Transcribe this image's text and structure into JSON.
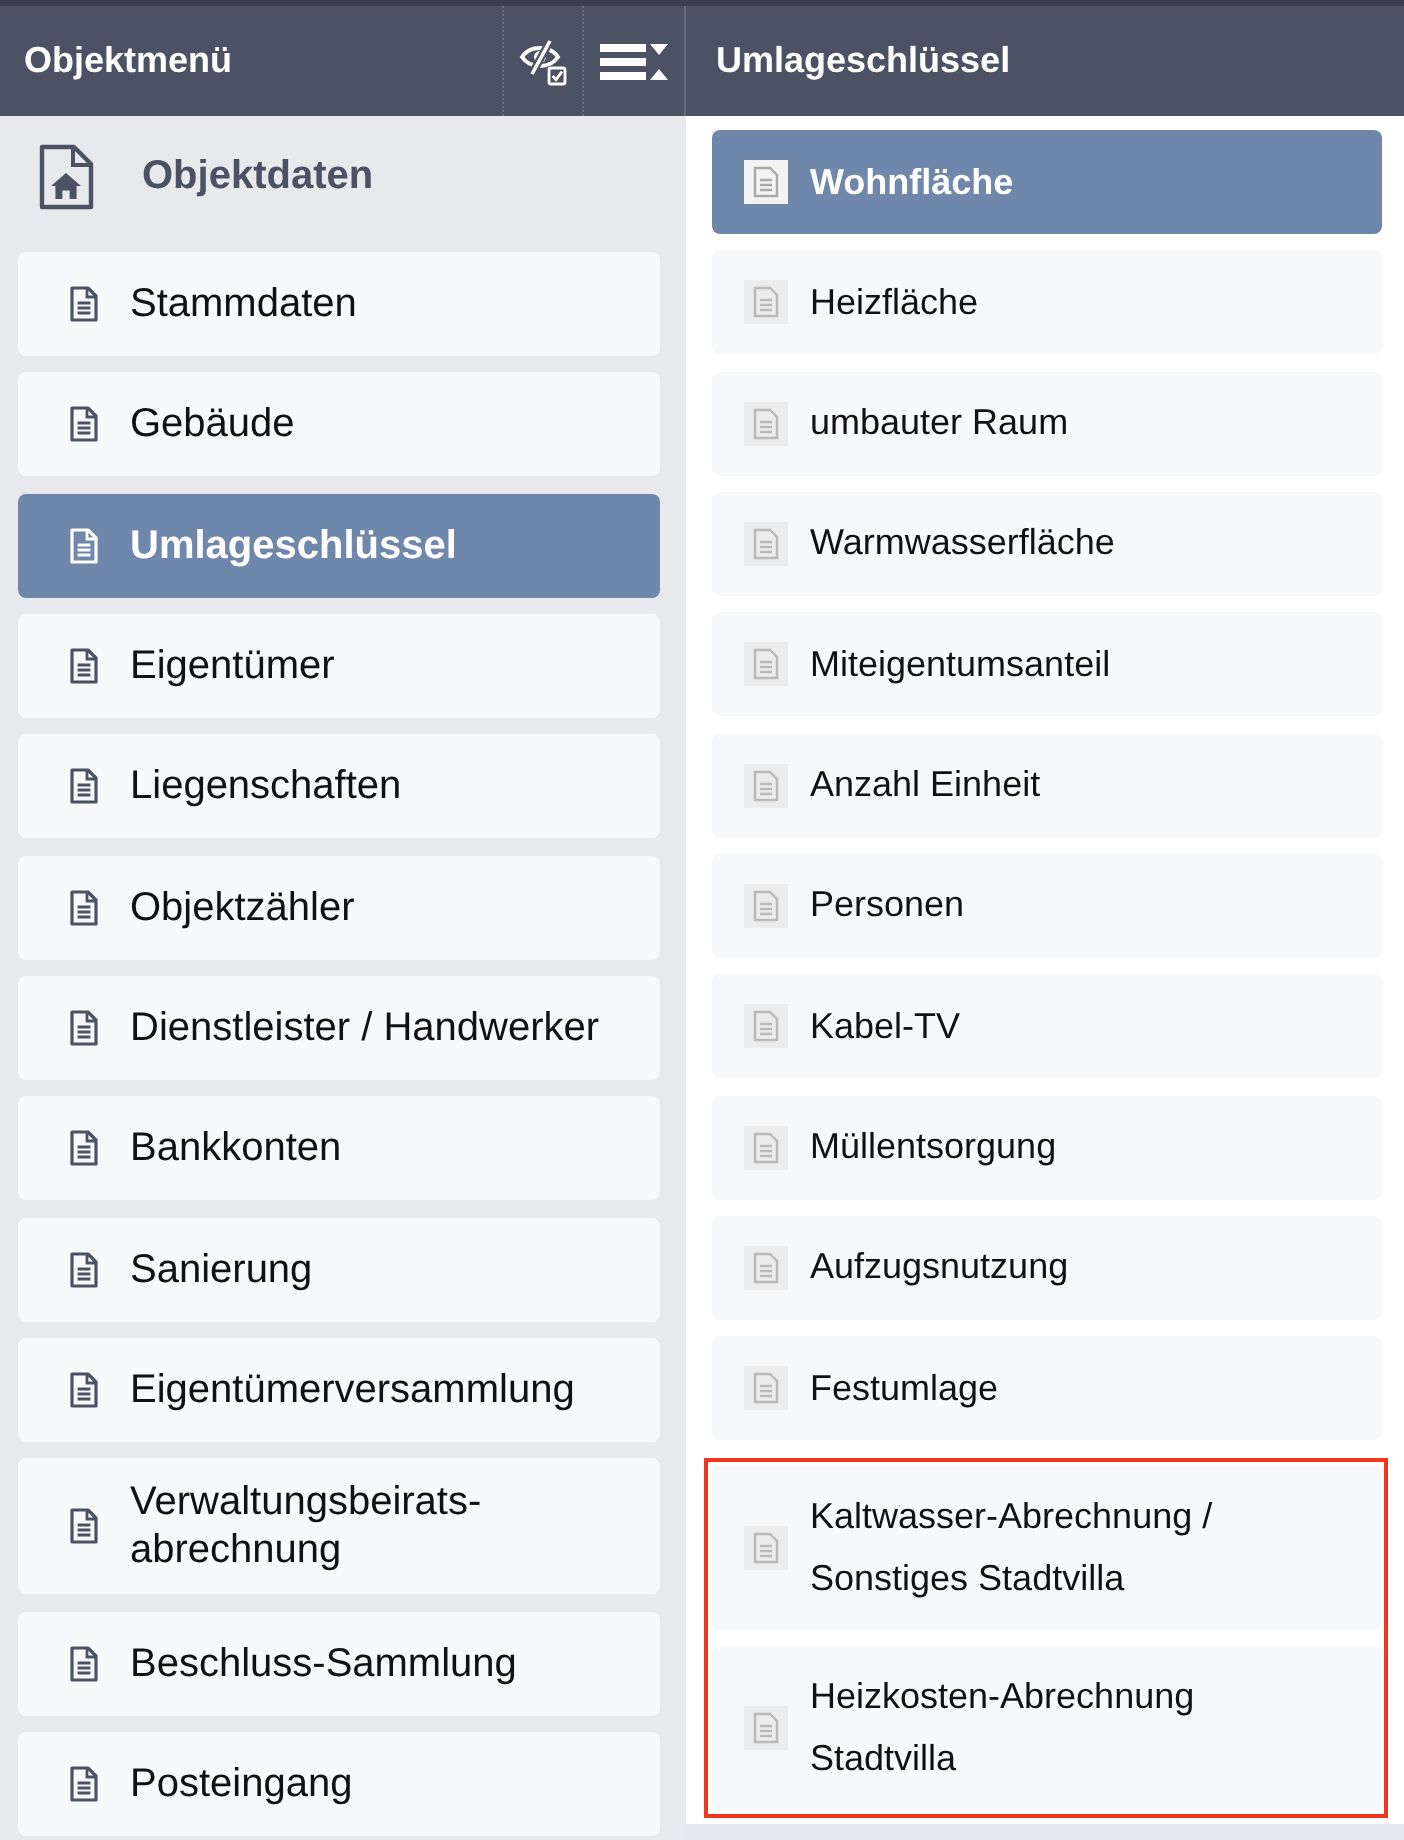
{
  "left_panel": {
    "title": "Objektmenü",
    "section": {
      "title": "Objektdaten"
    },
    "items": [
      {
        "label": "Stammdaten",
        "selected": false
      },
      {
        "label": "Gebäude",
        "selected": false
      },
      {
        "label": "Umlageschlüssel",
        "selected": true
      },
      {
        "label": "Eigentümer",
        "selected": false
      },
      {
        "label": "Liegenschaften",
        "selected": false
      },
      {
        "label": "Objektzähler",
        "selected": false
      },
      {
        "label": "Dienstleister / Handwerker",
        "selected": false
      },
      {
        "label": "Bankkonten",
        "selected": false
      },
      {
        "label": "Sanierung",
        "selected": false
      },
      {
        "label": "Eigentümerversammlung",
        "selected": false
      },
      {
        "label": "Verwaltungsbeirats-abrechnung",
        "selected": false
      },
      {
        "label": "Beschluss-Sammlung",
        "selected": false
      },
      {
        "label": "Posteingang",
        "selected": false
      }
    ]
  },
  "right_panel": {
    "title": "Umlageschlüssel",
    "items": [
      {
        "label": "Wohnfläche",
        "selected": true,
        "highlighted": false
      },
      {
        "label": "Heizfläche",
        "selected": false,
        "highlighted": false
      },
      {
        "label": "umbauter Raum",
        "selected": false,
        "highlighted": false
      },
      {
        "label": "Warmwasserfläche",
        "selected": false,
        "highlighted": false
      },
      {
        "label": "Miteigentumsanteil",
        "selected": false,
        "highlighted": false
      },
      {
        "label": "Anzahl Einheit",
        "selected": false,
        "highlighted": false
      },
      {
        "label": "Personen",
        "selected": false,
        "highlighted": false
      },
      {
        "label": "Kabel-TV",
        "selected": false,
        "highlighted": false
      },
      {
        "label": "Müllentsorgung",
        "selected": false,
        "highlighted": false
      },
      {
        "label": "Aufzugsnutzung",
        "selected": false,
        "highlighted": false
      },
      {
        "label": "Festumlage",
        "selected": false,
        "highlighted": false
      },
      {
        "label": "Kaltwasser-Abrechnung / Sonstiges Stadtvilla",
        "selected": false,
        "highlighted": true
      },
      {
        "label": "Heizkosten-Abrechnung Stadtvilla",
        "selected": false,
        "highlighted": true
      }
    ]
  }
}
